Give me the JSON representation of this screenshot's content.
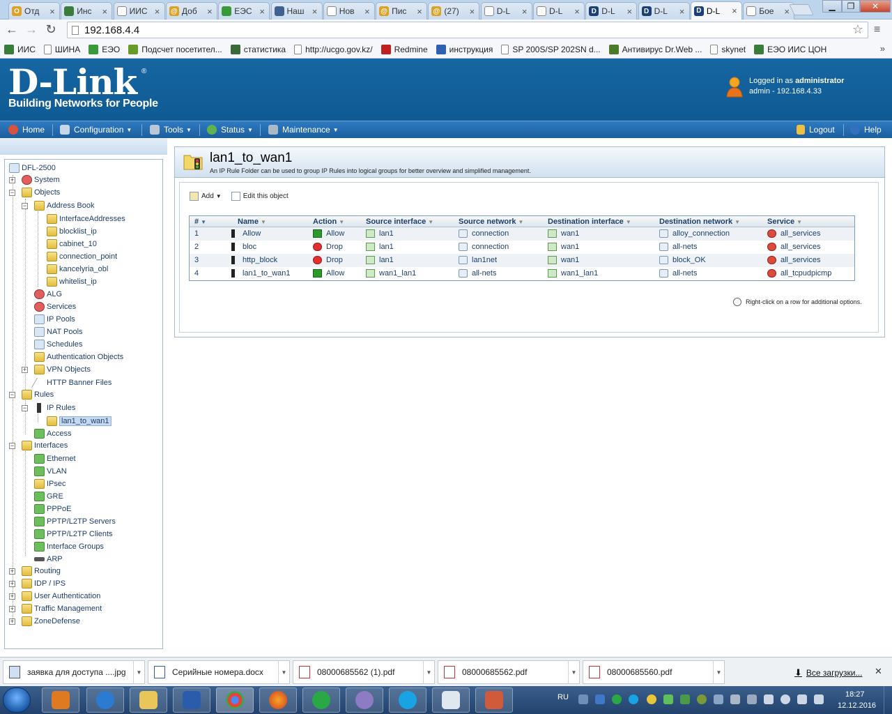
{
  "browser": {
    "tabs": [
      {
        "title": "Отд",
        "color": "#e0a020",
        "glyph": "O"
      },
      {
        "title": "Инс",
        "color": "#3a7d3a",
        "glyph": ""
      },
      {
        "title": "ИИС",
        "color": "#ffffff",
        "glyph": ""
      },
      {
        "title": "Доб",
        "color": "#e0a020",
        "glyph": "@"
      },
      {
        "title": "ЕЭС",
        "color": "#3a9a3a",
        "glyph": ""
      },
      {
        "title": "Наш",
        "color": "#406090",
        "glyph": ""
      },
      {
        "title": "Нов",
        "color": "#ffffff",
        "glyph": ""
      },
      {
        "title": "Пис",
        "color": "#e0a020",
        "glyph": "@"
      },
      {
        "title": "(27)",
        "color": "#e0a020",
        "glyph": "@"
      },
      {
        "title": "D-L",
        "color": "#ffffff",
        "glyph": ""
      },
      {
        "title": "D-L",
        "color": "#ffffff",
        "glyph": ""
      },
      {
        "title": "D-L",
        "color": "#1b3f7a",
        "glyph": "D"
      },
      {
        "title": "D-L",
        "color": "#1b3f7a",
        "glyph": "D"
      },
      {
        "title": "D-L",
        "color": "#1b3f7a",
        "glyph": "D"
      },
      {
        "title": "Бое",
        "color": "#ffffff",
        "glyph": ""
      }
    ],
    "active_tab_index": 13,
    "url": "192.168.4.4",
    "bookmarks": [
      {
        "label": "ИИС",
        "color": "#3a7d3a"
      },
      {
        "label": "ШИНА",
        "color": "page"
      },
      {
        "label": "ЕЭО",
        "color": "#3a9a3a"
      },
      {
        "label": "Подсчет посетител...",
        "color": "#6a9a2a"
      },
      {
        "label": "статистика",
        "color": "#3a6a3a"
      },
      {
        "label": "http://ucgo.gov.kz/",
        "color": "page"
      },
      {
        "label": "Redmine",
        "color": "#c02020"
      },
      {
        "label": "инструкция",
        "color": "#3060b0"
      },
      {
        "label": "SP 200S/SP 202SN d...",
        "color": "page"
      },
      {
        "label": "Антивирус Dr.Web ...",
        "color": "#4a7a2a"
      },
      {
        "label": "skynet",
        "color": "page"
      },
      {
        "label": "ЕЭО ИИС ЦОН",
        "color": "#3a7d3a"
      }
    ],
    "bookmarks_more": "»"
  },
  "header": {
    "logo": "D-Link",
    "logo_mark": "®",
    "tagline": "Building Networks for People",
    "logged_in_prefix": "Logged in as ",
    "logged_in_user": "administrator",
    "login_detail": "admin - 192.168.4.33"
  },
  "nav": {
    "home": "Home",
    "configuration": "Configuration",
    "tools": "Tools",
    "status": "Status",
    "maintenance": "Maintenance",
    "logout": "Logout",
    "help": "Help"
  },
  "tree": {
    "root": "DFL-2500",
    "system": "System",
    "objects": "Objects",
    "address_book": "Address Book",
    "interface_addresses": "InterfaceAddresses",
    "blocklist_ip": "blocklist_ip",
    "cabinet_10": "cabinet_10",
    "connection_point": "connection_point",
    "kancelyria_obl": "kancelyria_obl",
    "whitelist_ip": "whitelist_ip",
    "alg": "ALG",
    "services": "Services",
    "ip_pools": "IP Pools",
    "nat_pools": "NAT Pools",
    "schedules": "Schedules",
    "auth_objects": "Authentication Objects",
    "vpn_objects": "VPN Objects",
    "http_banner_files": "HTTP Banner Files",
    "rules": "Rules",
    "ip_rules": "IP Rules",
    "lan1_to_wan1": "lan1_to_wan1",
    "access": "Access",
    "interfaces": "Interfaces",
    "ethernet": "Ethernet",
    "vlan": "VLAN",
    "ipsec": "IPsec",
    "gre": "GRE",
    "pppoe": "PPPoE",
    "pptp_servers": "PPTP/L2TP Servers",
    "pptp_clients": "PPTP/L2TP Clients",
    "interface_groups": "Interface Groups",
    "arp": "ARP",
    "routing": "Routing",
    "idp_ips": "IDP / IPS",
    "user_auth": "User Authentication",
    "traffic_mgmt": "Traffic Management",
    "zonedefense": "ZoneDefense"
  },
  "content": {
    "title": "lan1_to_wan1",
    "description": "An IP Rule Folder can be used to group IP Rules into logical groups for better overview and simplified management.",
    "add_label": "Add",
    "edit_label": "Edit this object",
    "columns": {
      "num": "#",
      "name": "Name",
      "action": "Action",
      "src_if": "Source interface",
      "src_net": "Source network",
      "dst_if": "Destination interface",
      "dst_net": "Destination network",
      "service": "Service"
    },
    "rows": [
      {
        "num": "1",
        "name": "Allow",
        "action": "Allow",
        "src_if": "lan1",
        "src_net": "connection",
        "dst_if": "wan1",
        "dst_net": "alloy_connection",
        "service": "all_services"
      },
      {
        "num": "2",
        "name": "bloc",
        "action": "Drop",
        "src_if": "lan1",
        "src_net": "connection",
        "dst_if": "wan1",
        "dst_net": "all-nets",
        "service": "all_services"
      },
      {
        "num": "3",
        "name": "http_block",
        "action": "Drop",
        "src_if": "lan1",
        "src_net": "lan1net",
        "dst_if": "wan1",
        "dst_net": "block_OK",
        "service": "all_services"
      },
      {
        "num": "4",
        "name": "lan1_to_wan1",
        "action": "Allow",
        "src_if": "wan1_lan1",
        "src_net": "all-nets",
        "dst_if": "wan1_lan1",
        "dst_net": "all-nets",
        "service": "all_tcpudpicmp"
      }
    ],
    "hint": "Right-click on a row for additional options."
  },
  "downloads": {
    "items": [
      {
        "name": "заявка для доступа ....jpg",
        "type": "jpg"
      },
      {
        "name": "Серийные номера.docx",
        "type": "doc"
      },
      {
        "name": "08000685562 (1).pdf",
        "type": "pdf"
      },
      {
        "name": "08000685562.pdf",
        "type": "pdf"
      },
      {
        "name": "08000685560.pdf",
        "type": "pdf"
      }
    ],
    "all_label": "Все загрузки...",
    "close": "✕"
  },
  "taskbar": {
    "lang": "RU",
    "time": "18:27",
    "date": "12.12.2016"
  }
}
